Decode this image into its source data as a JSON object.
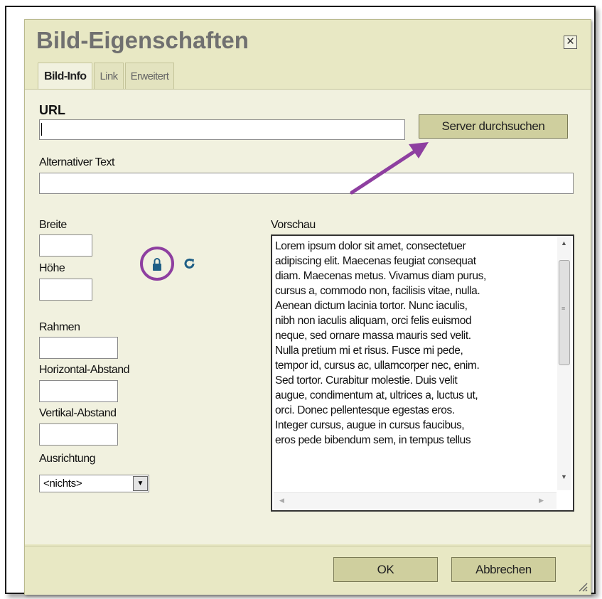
{
  "dialog": {
    "title": "Bild-Eigenschaften",
    "close_glyph": "✕"
  },
  "tabs": [
    {
      "label": "Bild-Info",
      "active": true
    },
    {
      "label": "Link",
      "active": false
    },
    {
      "label": "Erweitert",
      "active": false
    }
  ],
  "form": {
    "url_label": "URL",
    "url_value": "",
    "browse_button": "Server durchsuchen",
    "alt_label": "Alternativer Text",
    "alt_value": "",
    "width_label": "Breite",
    "height_label": "Höhe",
    "border_label": "Rahmen",
    "hspace_label": "Horizontal-Abstand",
    "vspace_label": "Vertikal-Abstand",
    "align_label": "Ausrichtung",
    "align_value": "<nichts>"
  },
  "preview": {
    "label": "Vorschau",
    "lines": [
      "Lorem ipsum dolor sit amet, consectetuer",
      "adipiscing elit. Maecenas feugiat consequat",
      "diam. Maecenas metus. Vivamus diam purus,",
      "cursus a, commodo non, facilisis vitae, nulla.",
      "Aenean dictum lacinia tortor. Nunc iaculis,",
      "nibh non iaculis aliquam, orci felis euismod",
      "neque, sed ornare massa mauris sed velit.",
      "Nulla pretium mi et risus. Fusce mi pede,",
      "tempor id, cursus ac, ullamcorper nec, enim.",
      "Sed tortor. Curabitur molestie. Duis velit",
      "augue, condimentum at, ultrices a, luctus ut,",
      "orci. Donec pellentesque egestas eros.",
      "Integer cursus, augue in cursus faucibus,",
      "eros pede bibendum sem, in tempus tellus"
    ]
  },
  "footer": {
    "ok_button": "OK",
    "cancel_button": "Abbrechen"
  },
  "icons": {
    "lock": "lock-icon",
    "reset": "reset-size-icon"
  },
  "colors": {
    "dialog_bg": "#e8e8c4",
    "panel_bg": "#f1f1df",
    "button_bg": "#cfcf9e",
    "annotation": "#8e3fa0",
    "icon_blue": "#1f5f86"
  }
}
